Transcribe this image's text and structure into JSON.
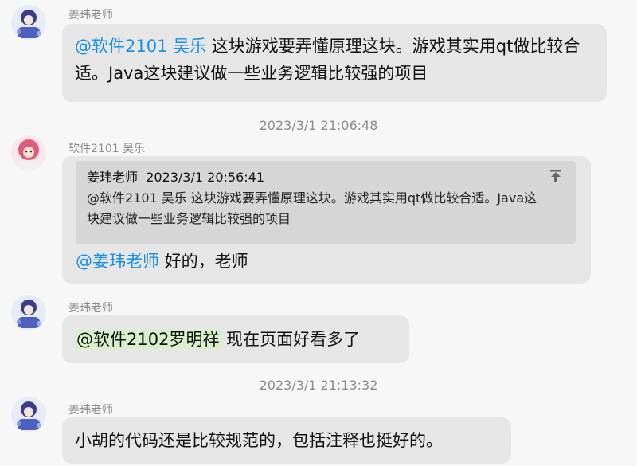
{
  "messages": [
    {
      "sender": "姜玮老师",
      "mention": "@软件2101 吴乐",
      "text": " 这块游戏要弄懂原理这块。游戏其实用qt做比较合适。Java这块建议做一些业务逻辑比较强的项目"
    },
    {
      "timestamp": "2023/3/1 21:06:48",
      "sender": "软件2101 吴乐",
      "quote": {
        "author": "姜玮老师",
        "time": "2023/3/1 20:56:41",
        "text": "@软件2101 吴乐 这块游戏要弄懂原理这块。游戏其实用qt做比较合适。Java这块建议做一些业务逻辑比较强的项目"
      },
      "mention": "@姜玮老师",
      "text": " 好的，老师"
    },
    {
      "sender": "姜玮老师",
      "mention": "@软件2102罗明祥",
      "text": " 现在页面好看多了"
    },
    {
      "timestamp": "2023/3/1 21:13:32",
      "sender": "姜玮老师",
      "text": "小胡的代码还是比较规范的，包括注释也挺好的。"
    }
  ],
  "icons": {
    "jump_to_quote": "arrow-up-to-line-icon"
  },
  "colors": {
    "mention": "#1a8fe6",
    "bubble": "#e6e6e6",
    "quote_bg": "#d6d6d6",
    "mention_highlight": "#d7f0c9"
  }
}
